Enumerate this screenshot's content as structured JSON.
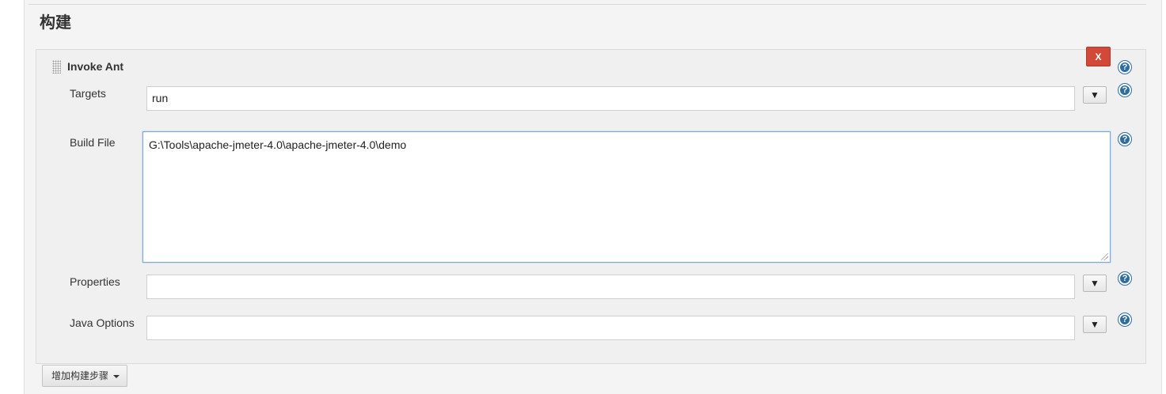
{
  "section": {
    "title": "构建"
  },
  "step": {
    "title": "Invoke Ant",
    "delete_label": "X",
    "help_glyph": "?"
  },
  "fields": {
    "targets": {
      "label": "Targets",
      "value": "run",
      "dropdown_glyph": "▼"
    },
    "build_file": {
      "label": "Build File",
      "value": "G:\\Tools\\apache-jmeter-4.0\\apache-jmeter-4.0\\demo"
    },
    "properties": {
      "label": "Properties",
      "value": "",
      "dropdown_glyph": "▼"
    },
    "java_options": {
      "label": "Java Options",
      "value": "",
      "dropdown_glyph": "▼"
    }
  },
  "add_step": {
    "label": "增加构建步骤"
  },
  "colors": {
    "delete": "#d24939",
    "help": "#2e6ca4",
    "focus_border": "#7aa6dc"
  },
  "icons": {
    "help": "question-circle-icon",
    "drag": "drag-handle-icon",
    "caret": "caret-down-icon"
  }
}
